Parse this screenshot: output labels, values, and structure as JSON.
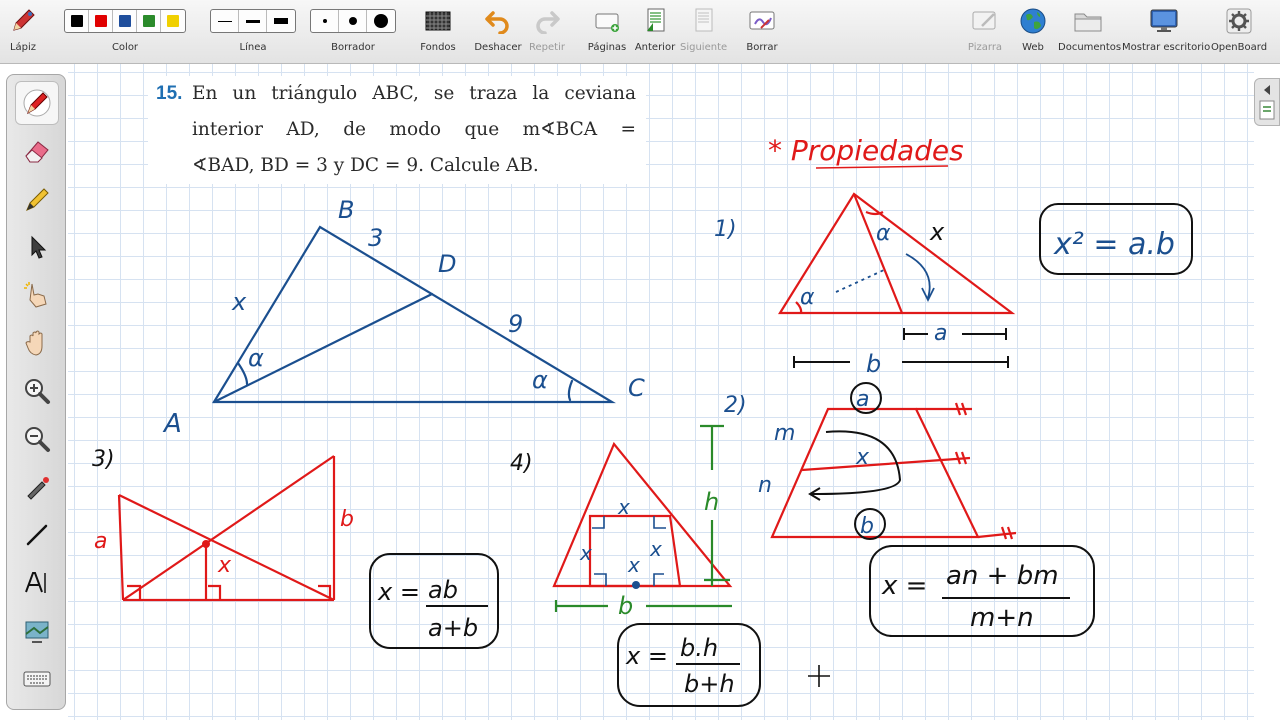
{
  "toolbar": {
    "pencil": "Lápiz",
    "color": "Color",
    "line": "Línea",
    "eraser": "Borrador",
    "backgrounds": "Fondos",
    "undo": "Deshacer",
    "redo": "Repetir",
    "pages": "Páginas",
    "previous": "Anterior",
    "next": "Siguiente",
    "clear": "Borrar",
    "whiteboard": "Pizarra",
    "web": "Web",
    "documents": "Documentos",
    "show_desktop": "Mostrar escritorio",
    "openboard": "OpenBoard",
    "colors": [
      "#000000",
      "#e00000",
      "#1f4e9c",
      "#2a8a2a",
      "#f0d000"
    ]
  },
  "problem": {
    "number": "15.",
    "line1": "En un triángulo ABC, se traza la ceviana",
    "line2": "interior AD, de modo que m∢BCA =",
    "line3": "∢BAD, BD = 3 y DC = 9. Calcule AB."
  },
  "figure_main": {
    "vertex_a": "A",
    "vertex_b": "B",
    "vertex_c": "C",
    "vertex_d": "D",
    "side_bd": "3",
    "side_dc": "9",
    "side_ab": "x",
    "angle_a": "α",
    "angle_c": "α"
  },
  "properties": {
    "heading": "* Propiedades",
    "p1": {
      "label": "1)",
      "angle_left": "α",
      "angle_top": "α",
      "side_x": "x",
      "seg_a": "a",
      "seg_b": "b",
      "formula": "x² = a.b"
    },
    "p2": {
      "label": "2)",
      "base_a": "a",
      "base_b": "b",
      "mid_x": "x",
      "seg_m": "m",
      "seg_n": "n",
      "formula_num": "an + bm",
      "formula_den": "m+n",
      "formula_lhs": "x ="
    },
    "p3": {
      "label": "3)",
      "side_a": "a",
      "side_b": "b",
      "mid_x": "x",
      "formula_lhs": "x =",
      "formula_num": "ab",
      "formula_den": "a+b"
    },
    "p4": {
      "label": "4)",
      "square_top": "x",
      "square_left": "x",
      "square_right": "x",
      "square_bottom": "x",
      "height_h": "h",
      "base_b": "b",
      "formula_lhs": "x =",
      "formula_num": "b.h",
      "formula_den": "b+h"
    }
  }
}
